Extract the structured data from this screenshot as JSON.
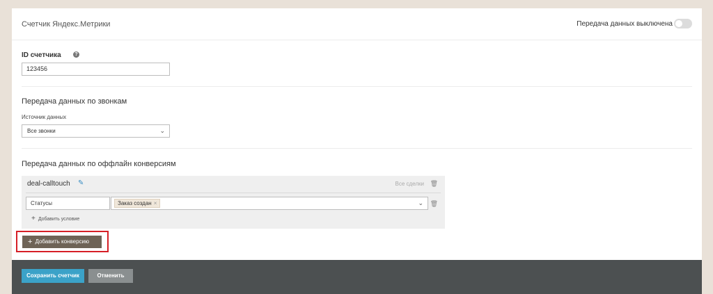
{
  "header": {
    "title": "Счетчик Яндекс.Метрики",
    "toggle_label": "Передача данных выключена",
    "toggle_on": false
  },
  "counter_id": {
    "label": "ID счетчика",
    "help_icon": "question-circle-icon",
    "value": "123456"
  },
  "calls": {
    "title": "Передача данных по звонкам",
    "source_label": "Источник данных",
    "source_value": "Все звонки"
  },
  "offline": {
    "title": "Передача данных по оффлайн конверсиям",
    "conversion": {
      "name": "deal-calltouch",
      "scope": "Все сделки",
      "condition_field": "Статусы",
      "tags": [
        "Заказ создан"
      ],
      "add_condition": "Добавить условие"
    },
    "add_conversion": "Добавить конверсию"
  },
  "footer": {
    "save_label": "Сохранить счетчик",
    "cancel_label": "Отменить"
  },
  "colors": {
    "background": "#e9e1d8",
    "save": "#3ba2c8",
    "add_conversion": "#6e6356",
    "highlight": "#d61f26",
    "footer": "#4c5051"
  }
}
